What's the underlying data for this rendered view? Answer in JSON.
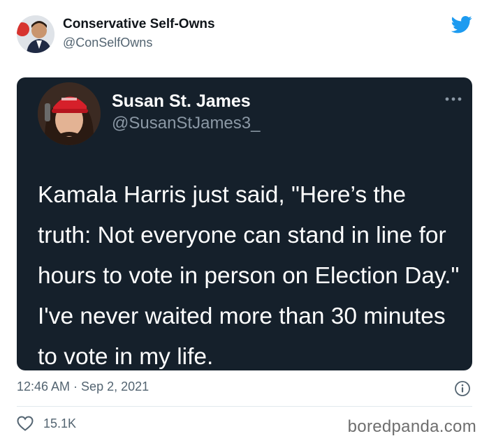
{
  "author": {
    "name": "Conservative Self-Owns",
    "handle": "@ConSelfOwns"
  },
  "quoted_tweet": {
    "name": "Susan St. James",
    "handle": "@SusanStJames3_",
    "text": "Kamala Harris just said, \"Here’s the truth: Not everyone can stand in line for hours to vote in person on Election Day.\" I've never waited more than 30 minutes to vote in my life."
  },
  "meta": {
    "timestamp": "12:46 AM · Sep 2, 2021",
    "likes": "15.1K"
  },
  "watermark": "boredpanda.com",
  "colors": {
    "twitter_blue": "#1d9bf0",
    "card_background": "#15202b",
    "secondary_text": "#536471"
  }
}
